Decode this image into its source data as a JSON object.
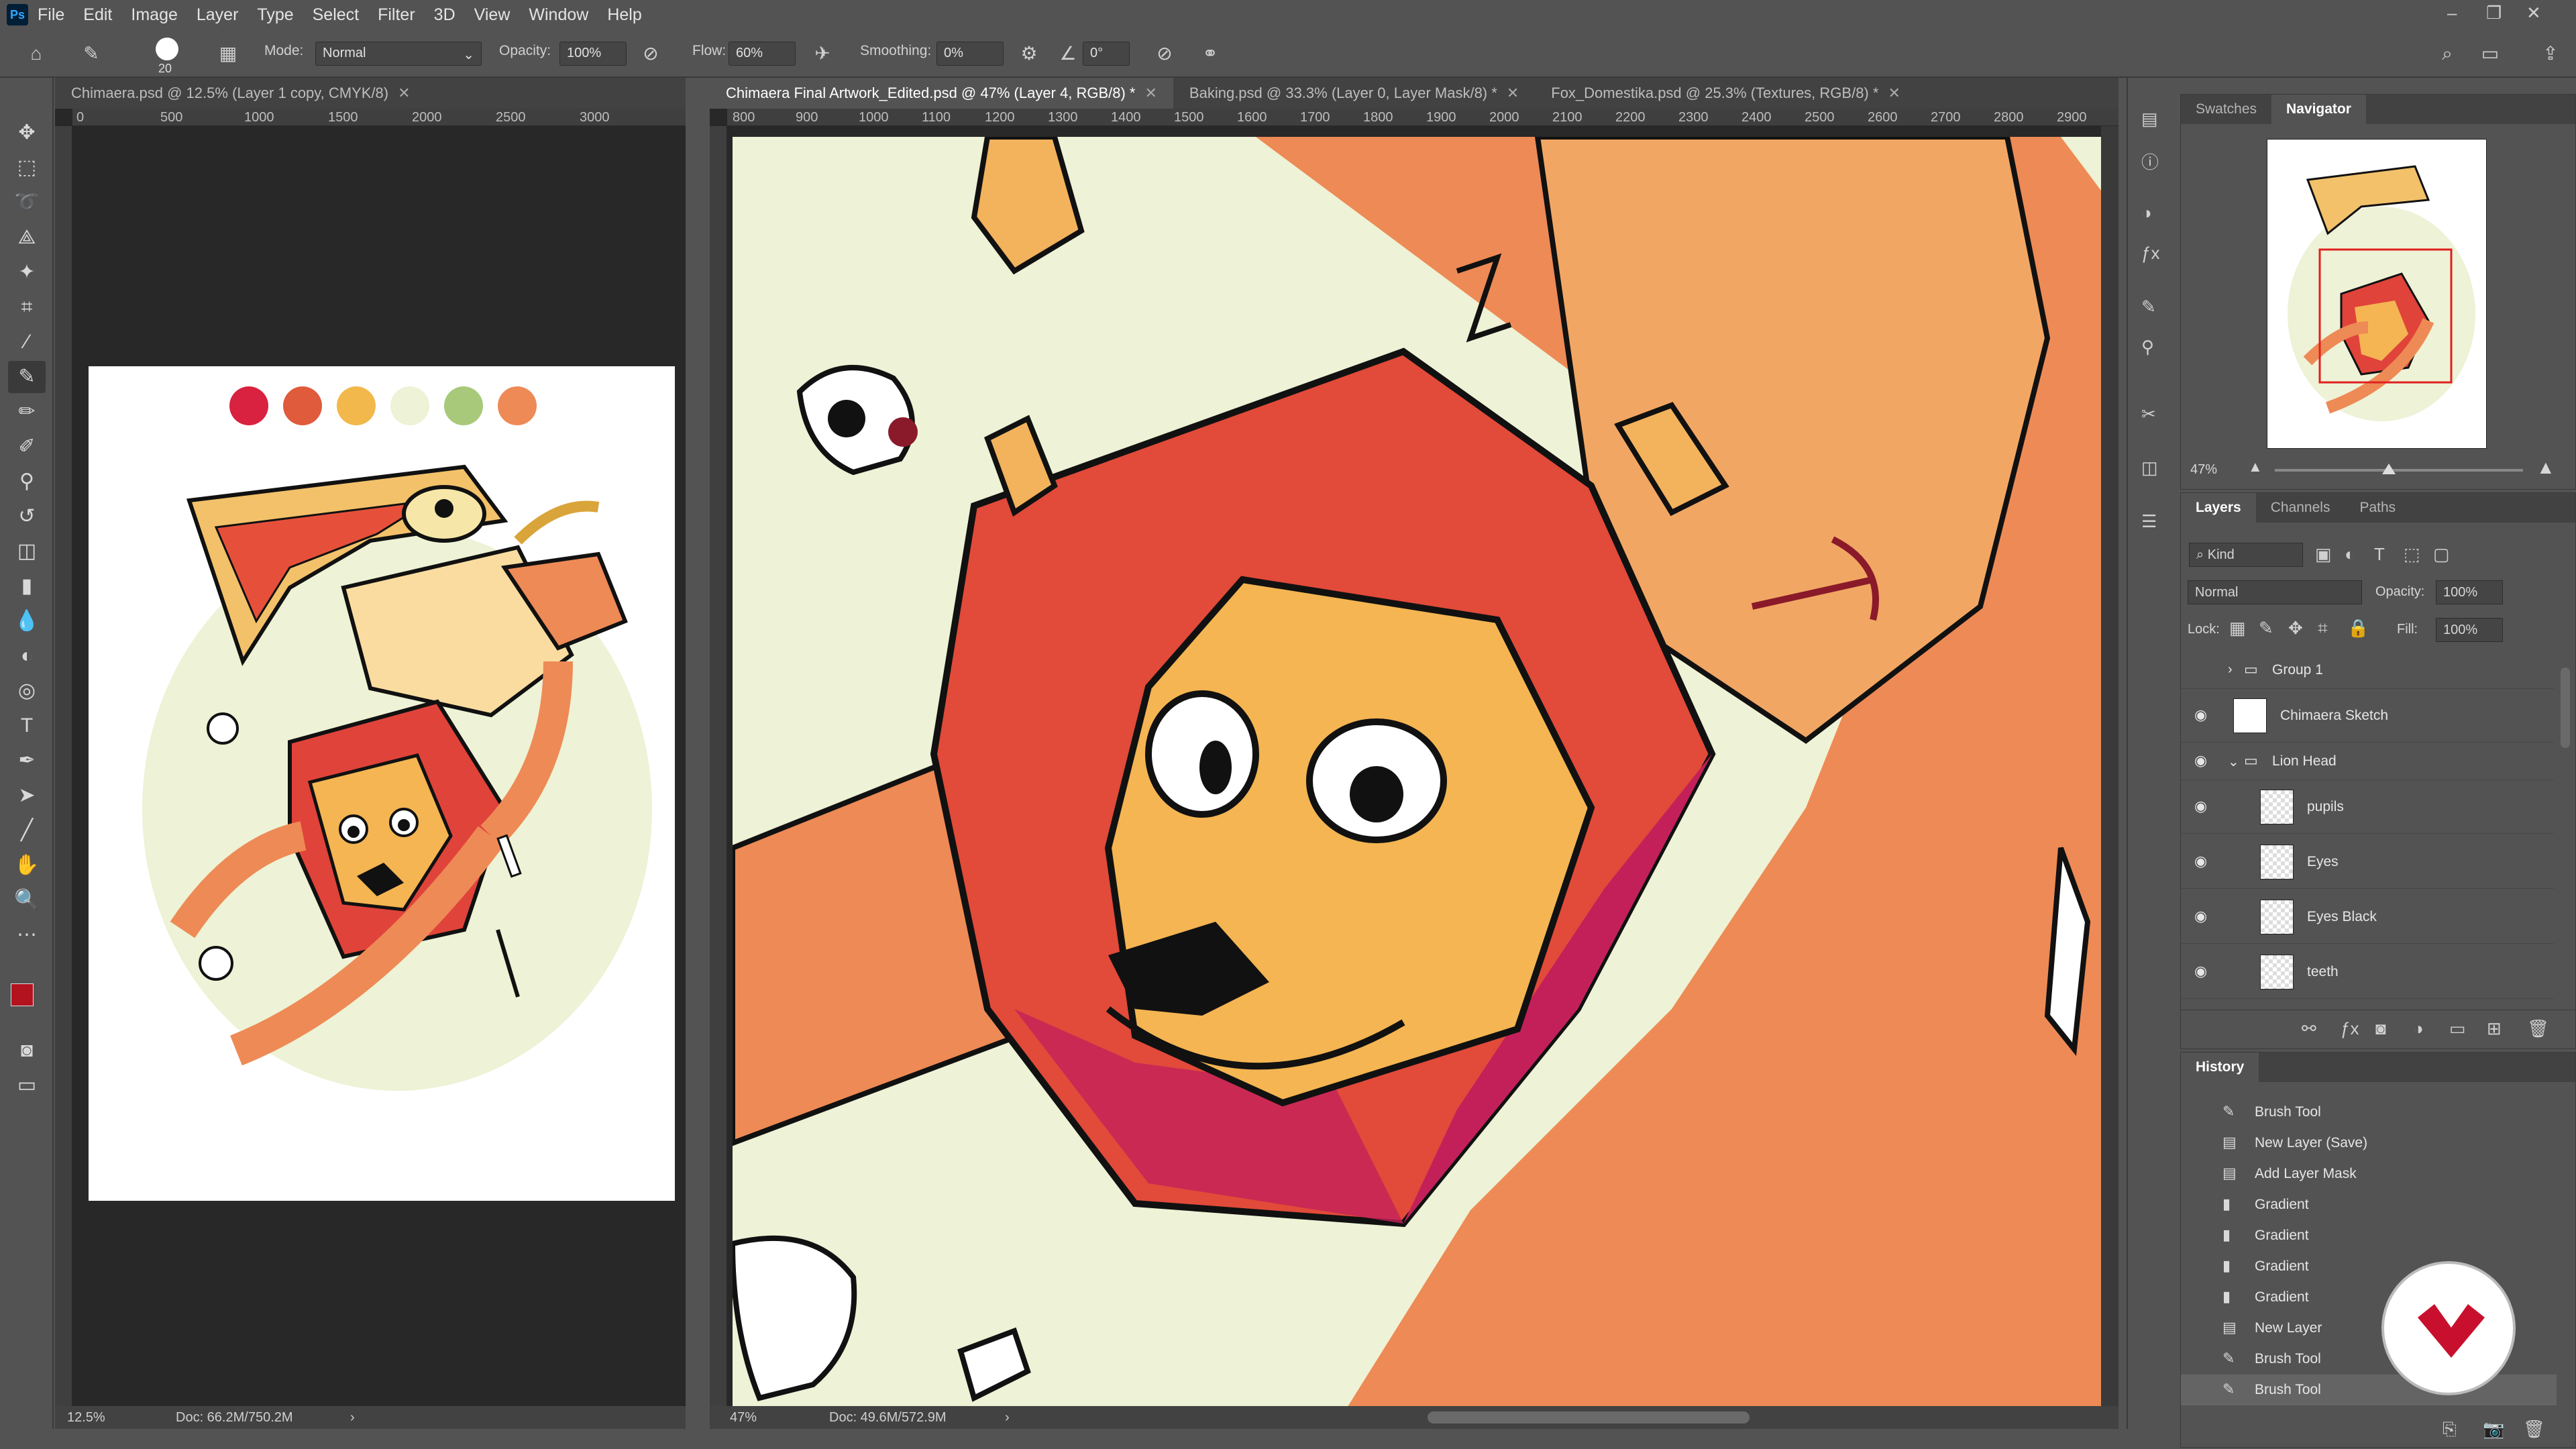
{
  "menu": [
    "File",
    "Edit",
    "Image",
    "Layer",
    "Type",
    "Select",
    "Filter",
    "3D",
    "View",
    "Window",
    "Help"
  ],
  "options": {
    "brush_size": "20",
    "mode_label": "Mode:",
    "mode_value": "Normal",
    "opacity_label": "Opacity:",
    "opacity_value": "100%",
    "flow_label": "Flow:",
    "flow_value": "60%",
    "smoothing_label": "Smoothing:",
    "smoothing_value": "0%",
    "angle_value": "0°"
  },
  "left_doc": {
    "tab": "Chimaera.psd @ 12.5% (Layer 1 copy, CMYK/8)",
    "ruler": [
      "0",
      "500",
      "1000",
      "1500",
      "2000",
      "2500",
      "3000"
    ],
    "zoom": "12.5%",
    "doc_size": "Doc: 66.2M/750.2M"
  },
  "main_doc": {
    "tabs": [
      {
        "label": "Chimaera Final Artwork_Edited.psd @ 47% (Layer 4, RGB/8) *",
        "active": true
      },
      {
        "label": "Baking.psd @ 33.3% (Layer 0, Layer Mask/8) *",
        "active": false
      },
      {
        "label": "Fox_Domestika.psd @ 25.3% (Textures, RGB/8) *",
        "active": false
      }
    ],
    "ruler": [
      "800",
      "900",
      "1000",
      "1100",
      "1200",
      "1300",
      "1400",
      "1500",
      "1600",
      "1700",
      "1800",
      "1900",
      "2000",
      "2100",
      "2200",
      "2300",
      "2400",
      "2500",
      "2600",
      "2700",
      "2800",
      "2900"
    ],
    "zoom": "47%",
    "doc_size": "Doc: 49.6M/572.9M"
  },
  "swatch_colors": [
    "#d8223f",
    "#e05a3c",
    "#f2b84b",
    "#eef2d6",
    "#a9c97a",
    "#ee8a55"
  ],
  "navigator": {
    "tabs": [
      "Swatches",
      "Navigator"
    ],
    "zoom": "47%"
  },
  "layers": {
    "tabs": [
      "Layers",
      "Channels",
      "Paths"
    ],
    "filter_kind": "Kind",
    "blend_mode": "Normal",
    "opacity_label": "Opacity:",
    "opacity_value": "100%",
    "lock_label": "Lock:",
    "fill_label": "Fill:",
    "fill_value": "100%",
    "items": [
      {
        "name": "Group 1",
        "type": "group",
        "visible": false
      },
      {
        "name": "Chimaera Sketch",
        "type": "layer",
        "visible": true
      },
      {
        "name": "Lion Head",
        "type": "group",
        "visible": true
      },
      {
        "name": "pupils",
        "type": "layer",
        "visible": true
      },
      {
        "name": "Eyes",
        "type": "layer",
        "visible": true
      },
      {
        "name": "Eyes Black",
        "type": "layer",
        "visible": true
      },
      {
        "name": "teeth",
        "type": "layer",
        "visible": true
      }
    ]
  },
  "history": {
    "title": "History",
    "items": [
      "Brush Tool",
      "New Layer (Save)",
      "Add Layer Mask",
      "Gradient",
      "Gradient",
      "Gradient",
      "Gradient",
      "New Layer",
      "Brush Tool",
      "Brush Tool"
    ]
  },
  "colors": {
    "foreground": "#b3121f",
    "background": "#ffffff",
    "brand_badge": "#c8102e"
  }
}
